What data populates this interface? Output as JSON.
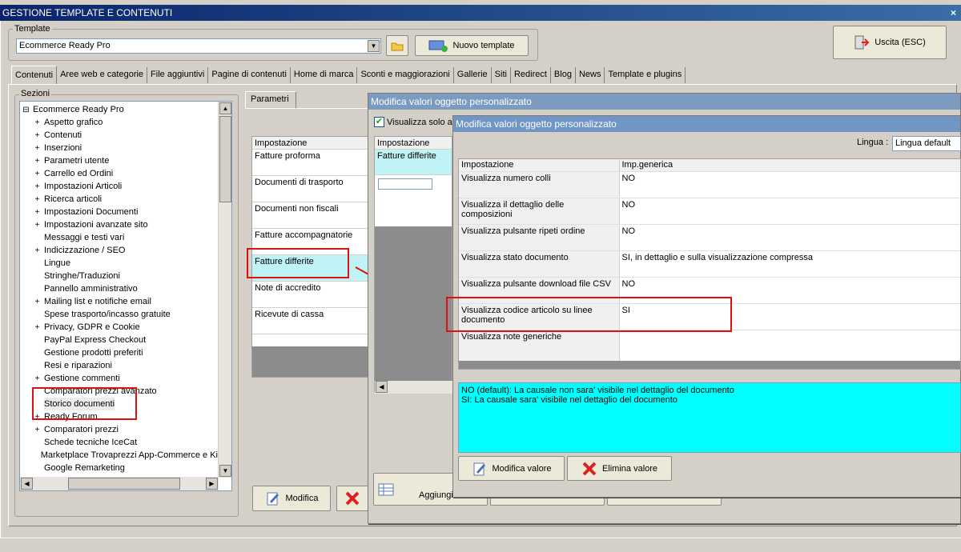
{
  "window": {
    "title": "GESTIONE TEMPLATE E CONTENUTI",
    "close": "×"
  },
  "template": {
    "group_label": "Template",
    "selected": "Ecommerce Ready Pro",
    "new_template_label": "Nuovo template",
    "exit_label": "Uscita (ESC)"
  },
  "tabs": [
    {
      "label": "Contenuti"
    },
    {
      "label": "Aree web e categorie"
    },
    {
      "label": "File aggiuntivi"
    },
    {
      "label": "Pagine di contenuti"
    },
    {
      "label": "Home di marca"
    },
    {
      "label": "Sconti e maggiorazioni"
    },
    {
      "label": "Gallerie"
    },
    {
      "label": "Siti"
    },
    {
      "label": "Redirect"
    },
    {
      "label": "Blog"
    },
    {
      "label": "News"
    },
    {
      "label": "Template e plugins"
    }
  ],
  "sections": {
    "label": "Sezioni",
    "root": "Ecommerce Ready Pro",
    "items": [
      {
        "label": "Aspetto grafico",
        "expandable": true
      },
      {
        "label": "Contenuti",
        "expandable": true
      },
      {
        "label": "Inserzioni",
        "expandable": true
      },
      {
        "label": "Parametri utente",
        "expandable": true
      },
      {
        "label": "Carrello ed Ordini",
        "expandable": true
      },
      {
        "label": "Impostazioni Articoli",
        "expandable": true
      },
      {
        "label": "Ricerca articoli",
        "expandable": true
      },
      {
        "label": "Impostazioni Documenti",
        "expandable": true
      },
      {
        "label": "Impostazioni avanzate sito",
        "expandable": true
      },
      {
        "label": "Messaggi e testi vari",
        "expandable": false
      },
      {
        "label": "Indicizzazione / SEO",
        "expandable": true
      },
      {
        "label": "Lingue",
        "expandable": false
      },
      {
        "label": "Stringhe/Traduzioni",
        "expandable": false
      },
      {
        "label": "Pannello amministrativo",
        "expandable": false
      },
      {
        "label": "Mailing list e notifiche email",
        "expandable": true
      },
      {
        "label": "Spese trasporto/incasso gratuite",
        "expandable": false
      },
      {
        "label": "Privacy, GDPR e Cookie",
        "expandable": true
      },
      {
        "label": "PayPal Express Checkout",
        "expandable": false
      },
      {
        "label": "Gestione prodotti preferiti",
        "expandable": false
      },
      {
        "label": "Resi e riparazioni",
        "expandable": false
      },
      {
        "label": "Gestione commenti",
        "expandable": true
      },
      {
        "label": "Comparatori prezzi avanzato",
        "expandable": false
      },
      {
        "label": "Storico documenti",
        "expandable": false
      },
      {
        "label": "Ready Forum",
        "expandable": true
      },
      {
        "label": "Comparatori prezzi",
        "expandable": true
      },
      {
        "label": "Schede tecniche IceCat",
        "expandable": false
      },
      {
        "label": "Marketplace Trovaprezzi App-Commerce e Ki",
        "expandable": false
      },
      {
        "label": "Google Remarketing",
        "expandable": false
      }
    ]
  },
  "params": {
    "tab_label": "Parametri",
    "header": "Impostazione",
    "rows": [
      "Fatture proforma",
      "Documenti di trasporto",
      "Documenti non fiscali",
      "Fatture accompagnatorie",
      "Fatture differite",
      "Note di accredito",
      "Ricevute di cassa"
    ],
    "modify_label": "Modifica"
  },
  "dialog_back": {
    "title": "Modifica valori oggetto personalizzato",
    "checkbox_label": "Visualizza solo an",
    "header": "Impostazione",
    "row": "Fatture differite",
    "add_label": "Aggiungi"
  },
  "dialog_front": {
    "title": "Modifica valori oggetto personalizzato",
    "language_label": "Lingua :",
    "language_value": "Lingua default",
    "col_setting": "Impostazione",
    "col_value": "Imp.generica",
    "rows": [
      {
        "setting": "Visualizza numero colli",
        "value": "NO"
      },
      {
        "setting": "Visualizza il dettaglio delle composizioni",
        "value": "NO"
      },
      {
        "setting": "Visualizza pulsante ripeti ordine",
        "value": "NO"
      },
      {
        "setting": "Visualizza stato documento",
        "value": "SI, in dettaglio e sulla visualizzazione compressa"
      },
      {
        "setting": "Visualizza pulsante download file CSV",
        "value": "NO"
      },
      {
        "setting": "Visualizza codice articolo su linee documento",
        "value": "SI"
      },
      {
        "setting": "Visualizza note generiche",
        "value": ""
      }
    ],
    "help_line1": "NO (default): La causale non sara' visibile nel dettaglio del documento",
    "help_line2": "SI: La causale sara' visibile nel dettaglio del documento",
    "modify_label": "Modifica valore",
    "delete_label": "Elimina valore"
  }
}
